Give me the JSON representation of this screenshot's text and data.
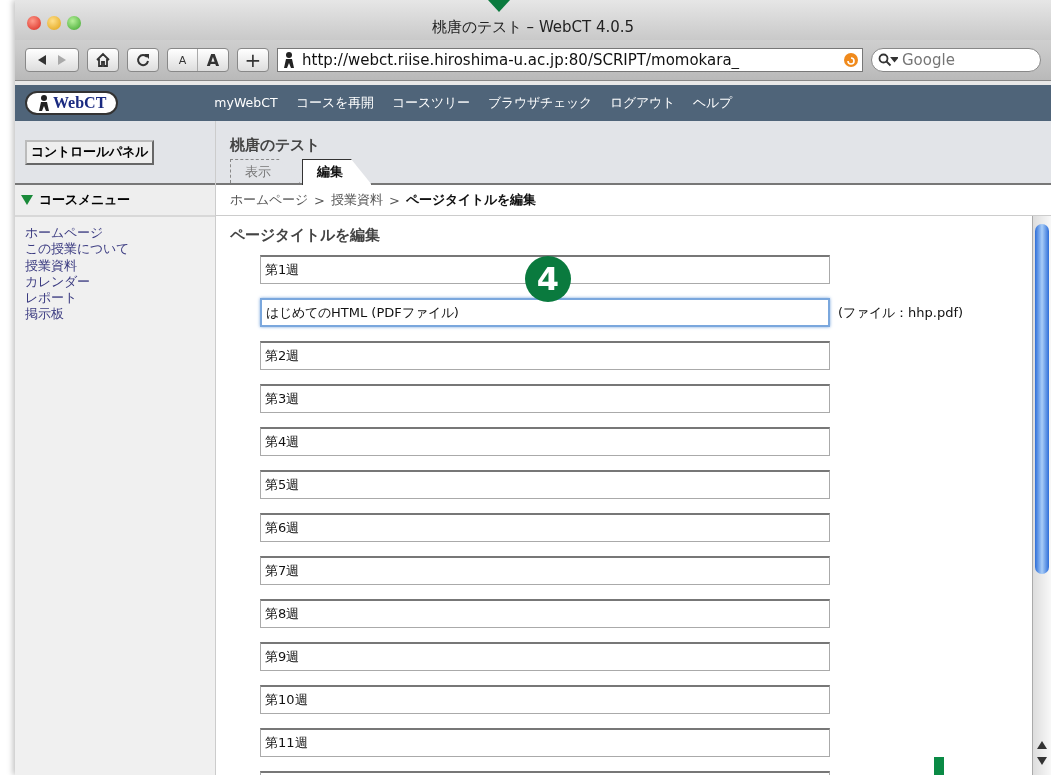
{
  "window": {
    "title": "桃唐のテスト – WebCT 4.0.5"
  },
  "toolbar": {
    "url": "http://webct.riise.hiroshima-u.ac.jp:80/SCRIPT/momokara_",
    "search_placeholder": "Google",
    "font_small": "A",
    "font_large": "A",
    "add": "+"
  },
  "nav": {
    "logo": "WebCT",
    "items": [
      "myWebCT",
      "コースを再開",
      "コースツリー",
      "ブラウザチェック",
      "ログアウト",
      "ヘルプ"
    ]
  },
  "control_panel": "コントロールパネル",
  "course_title": "桃唐のテスト",
  "tabs": [
    {
      "label": "表示",
      "selected": false
    },
    {
      "label": "編集",
      "selected": true
    }
  ],
  "course_menu": {
    "title": "コースメニュー",
    "expanded": true,
    "items": [
      "ホームページ",
      "この授業について",
      "授業資料",
      "カレンダー",
      "レポート",
      "掲示板"
    ]
  },
  "breadcrumb_separator": ">",
  "breadcrumb": [
    {
      "label": "ホームページ",
      "current": false
    },
    {
      "label": "授業資料",
      "current": false
    },
    {
      "label": "ページタイトルを編集",
      "current": true
    }
  ],
  "heading": "ページタイトルを編集",
  "fields": [
    {
      "value": "第1週",
      "focused": false
    },
    {
      "value": "はじめてのHTML (PDFファイル)",
      "focused": true,
      "note": "(ファイル：hhp.pdf)"
    },
    {
      "value": "第2週",
      "focused": false
    },
    {
      "value": "第3週",
      "focused": false
    },
    {
      "value": "第4週",
      "focused": false
    },
    {
      "value": "第5週",
      "focused": false
    },
    {
      "value": "第6週",
      "focused": false
    },
    {
      "value": "第7週",
      "focused": false
    },
    {
      "value": "第8週",
      "focused": false
    },
    {
      "value": "第9週",
      "focused": false
    },
    {
      "value": "第10週",
      "focused": false
    },
    {
      "value": "第11週",
      "focused": false
    },
    {
      "focused": false
    }
  ],
  "callout": "4"
}
